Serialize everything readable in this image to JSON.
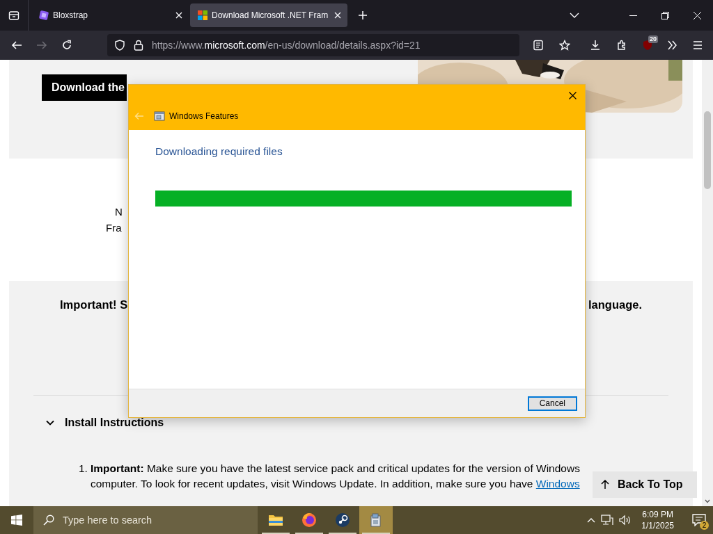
{
  "browser": {
    "tabs": [
      {
        "title": "Bloxstrap",
        "kind": "bloxstrap",
        "selected": false
      },
      {
        "title": "Download Microsoft .NET Fram",
        "kind": "microsoft",
        "selected": true
      }
    ],
    "forward_disabled": true,
    "url": "https://www.**microsoft.com**/en-us/download/details.aspx?id=21",
    "extension_badge": "20"
  },
  "page": {
    "download_button": "Download the",
    "partial_lines": [
      "N",
      "Fra"
    ],
    "notice_left": "Important! S",
    "notice_right": "language.",
    "section": {
      "title": "Install Instructions",
      "expanded": true
    },
    "instructions": [
      {
        "number": "1.",
        "lines": [
          "**Important:** Make sure you have the latest service pack and critical updates for the version of Windows",
          "computer. To look for recent updates, visit Windows Update. In addition, make sure you have "
        ],
        "link": "Windows"
      }
    ],
    "back_to_top": "Back To Top"
  },
  "dialog": {
    "title": "Windows Features",
    "back_disabled": true,
    "heading": "Downloading required files",
    "progress": {
      "level": 1
    },
    "buttons": [
      "Cancel"
    ]
  },
  "taskbar": {
    "search_placeholder": "Type here to search",
    "apps": [
      {
        "kind": "files",
        "selected": false
      },
      {
        "kind": "firefox",
        "selected": false
      },
      {
        "kind": "steam",
        "selected": false
      },
      {
        "kind": "installer",
        "selected": true
      }
    ],
    "time": "6:09 PM",
    "date": "1/1/2025",
    "notification_count": "2"
  }
}
